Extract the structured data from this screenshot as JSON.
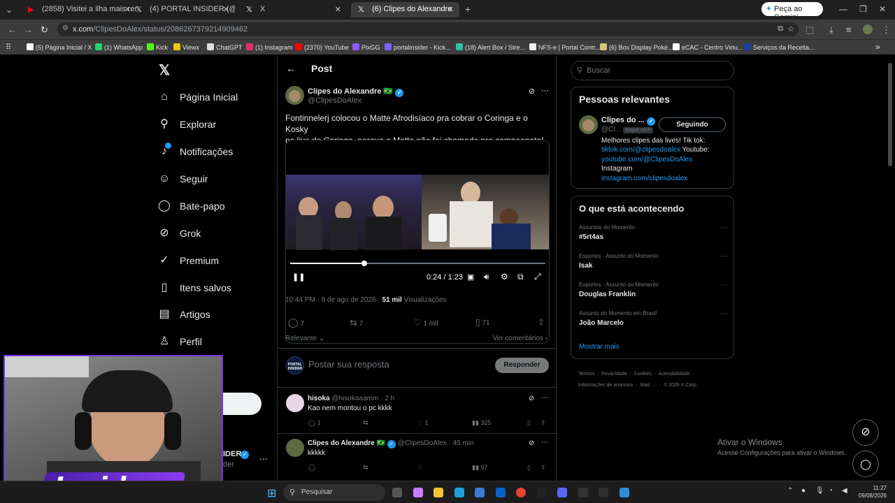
{
  "browser": {
    "tabs": [
      {
        "title": "(2858) Visitei a ilha mais remota",
        "icon": "youtube-icon",
        "color": "#ff0000"
      },
      {
        "title": "(4) PORTAL INSIDER (@Portal_In",
        "icon": "x-icon",
        "color": "#ffffff"
      },
      {
        "title": "X",
        "icon": "x-icon",
        "color": "#ffffff"
      },
      {
        "title": "(6) Clipes do Alexandre",
        "icon": "x-icon",
        "color": "#ffffff"
      }
    ],
    "gemini_label": "Peça ao Gemini",
    "url_host": "x.com",
    "url_path": "/ClipesDoAlex/status/2086267379214909462",
    "bookmarks": [
      {
        "label": "(5) Página Inicial / X",
        "color": "#ffffff"
      },
      {
        "label": "(1) WhatsApp",
        "color": "#25d366"
      },
      {
        "label": "Kick",
        "color": "#53fc18"
      },
      {
        "label": "Viewx",
        "color": "#f5c518"
      },
      {
        "label": "ChatGPT",
        "color": "#dddddd"
      },
      {
        "label": "(1) Instagram",
        "color": "#e1306c"
      },
      {
        "label": "(2370) YouTube",
        "color": "#ff0000"
      },
      {
        "label": "PixGG",
        "color": "#8a5cf6"
      },
      {
        "label": "portalinsider - Kick...",
        "color": "#7b61ff"
      },
      {
        "label": "(18) Alert Box / Stre...",
        "color": "#31c3a2"
      },
      {
        "label": "NFS-e | Portal Contr...",
        "color": "#f0f0f0"
      },
      {
        "label": "(6) Box Display Poké...",
        "color": "#d9c27a"
      },
      {
        "label": "eCAC - Centro Virtu...",
        "color": "#ffffff"
      },
      {
        "label": "Serviços da Receita...",
        "color": "#1a3fa8"
      }
    ]
  },
  "sidebar": {
    "items": [
      {
        "label": "Página Inicial",
        "icon": "home-icon",
        "glyph": "⌂"
      },
      {
        "label": "Explorar",
        "icon": "search-icon",
        "glyph": "⚲"
      },
      {
        "label": "Notificações",
        "icon": "bell-icon",
        "glyph": "♪"
      },
      {
        "label": "Seguir",
        "icon": "add-user-icon",
        "glyph": "☺"
      },
      {
        "label": "Bate-papo",
        "icon": "chat-icon",
        "glyph": "◯"
      },
      {
        "label": "Grok",
        "icon": "grok-icon",
        "glyph": "⊘"
      },
      {
        "label": "Premium",
        "icon": "premium-icon",
        "glyph": "✓"
      },
      {
        "label": "Itens salvos",
        "icon": "bookmark-icon",
        "glyph": "▯"
      },
      {
        "label": "Artigos",
        "icon": "article-icon",
        "glyph": "▤"
      },
      {
        "label": "Perfil",
        "icon": "profile-icon",
        "glyph": "♙"
      }
    ],
    "account_name": "IDER",
    "account_handle": "der"
  },
  "post": {
    "header": "Post",
    "author_name": "Clipes do Alexandre",
    "author_flag": "🇧🇷",
    "author_handle": "@ClipesDoAlex",
    "text_line1": "Fontinnelerj colocou o Matte Afrodisíaco pra cobrar o Coringa e o Kosky",
    "text_line2": "na live do Coringa, porque o Matte não foi chamado pro campeonato! 😂",
    "video_time": "0:24 / 1:23",
    "video_progress": 0.29,
    "timestamp": "10:44 PM · 8 de ago de 2026 · ",
    "views_count": "51 mil",
    "views_label": " Visualizações",
    "replies": "7",
    "reposts": "7",
    "likes": "1 mil",
    "bookmarks": "71",
    "sort_label": "Relevante",
    "see_comments": "Ver comentários",
    "reply_placeholder": "Postar sua resposta",
    "reply_button": "Responder",
    "reply_avatar_text": "PORTAL INSIDER"
  },
  "replies": [
    {
      "name": "hisoka",
      "handle": "@hisokaaamm · 2 h",
      "text": "Kao nem montou o pc kkkk",
      "replies": "1",
      "likes": "1",
      "views": "325"
    },
    {
      "name": "Clipes do Alexandre 🇧🇷",
      "handle": "@ClipesDoAlex · 45 min",
      "text": "kkkkk",
      "replies": "",
      "likes": "",
      "views": "97"
    }
  ],
  "right": {
    "search_placeholder": "Buscar",
    "people_title": "Pessoas relevantes",
    "person_name": "Clipes do ...",
    "person_handle": "@Cl...",
    "person_badge": "Segue você",
    "follow_button": "Seguindo",
    "bio_line1": "Melhores clipes das lives! Tik tok:",
    "bio_link1": "tiktok.com/@clipesdoalex",
    "bio_text2": " Youtube:",
    "bio_link2": "youtube.com/@ClipesDoAlex",
    "bio_text3": "Instagram",
    "bio_link3": "instagram.com/clipesdoalex",
    "trends_title": "O que está acontecendo",
    "trends": [
      {
        "context": "Assuntos do Momento",
        "name": "#5rt4as"
      },
      {
        "context": "Esportes · Assunto do Momento",
        "name": "Isak"
      },
      {
        "context": "Esportes · Assunto do Momento",
        "name": "Douglas Franklin"
      },
      {
        "context": "Assunto do Momento em Brasil",
        "name": "João Marcelo"
      }
    ],
    "show_more": "Mostrar mais",
    "footer1": "Termos  ·  Privacidade  ·  Cookies  ·  Acessibilidade  ·",
    "footer2": "Informações de anúncios  ·  Mais ···  ·  © 2026 X Corp."
  },
  "windows": {
    "activate_title": "Ativar o Windows",
    "activate_sub": "Acesse Configurações para ativar o Windows.",
    "search_placeholder": "Pesquisar",
    "time": "11:27",
    "date": "09/08/2026"
  },
  "overlay": {
    "logo_text": "Insider"
  }
}
